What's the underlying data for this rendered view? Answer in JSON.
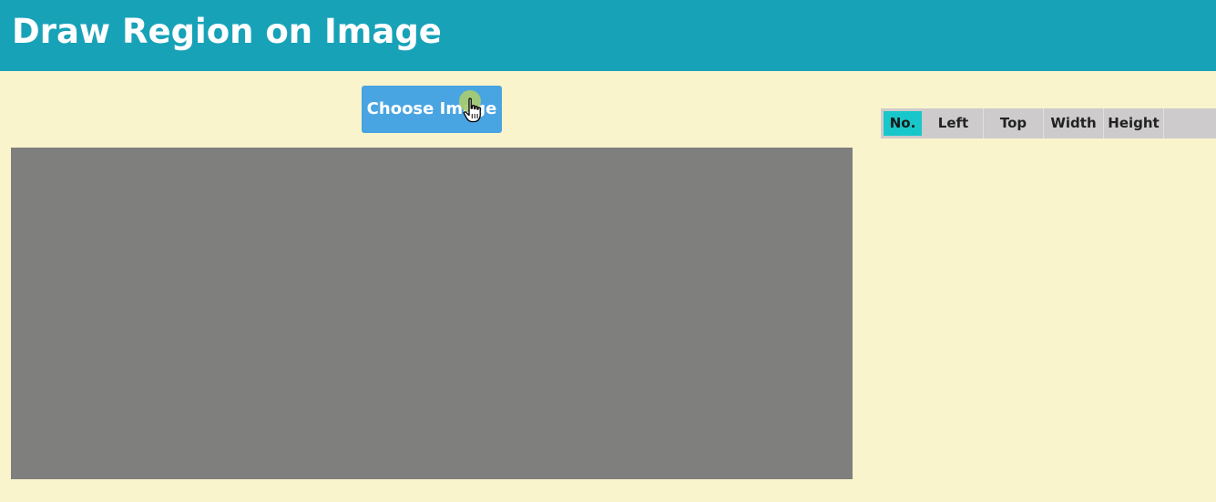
{
  "header": {
    "title": "Draw Region on Image",
    "background_color": "#18a2b8"
  },
  "toolbar": {
    "choose_image_label": "Choose Image",
    "button_color": "#49a4e2"
  },
  "canvas": {
    "background_color": "#7f7f7e"
  },
  "regions_table": {
    "columns": [
      "No.",
      "Left",
      "Top",
      "Width",
      "Height",
      ""
    ],
    "active_column_color": "#18c7c9",
    "rows": []
  },
  "cursor": {
    "icon": "hand-pointer-icon"
  },
  "page": {
    "background_color": "#f9f4cc"
  }
}
